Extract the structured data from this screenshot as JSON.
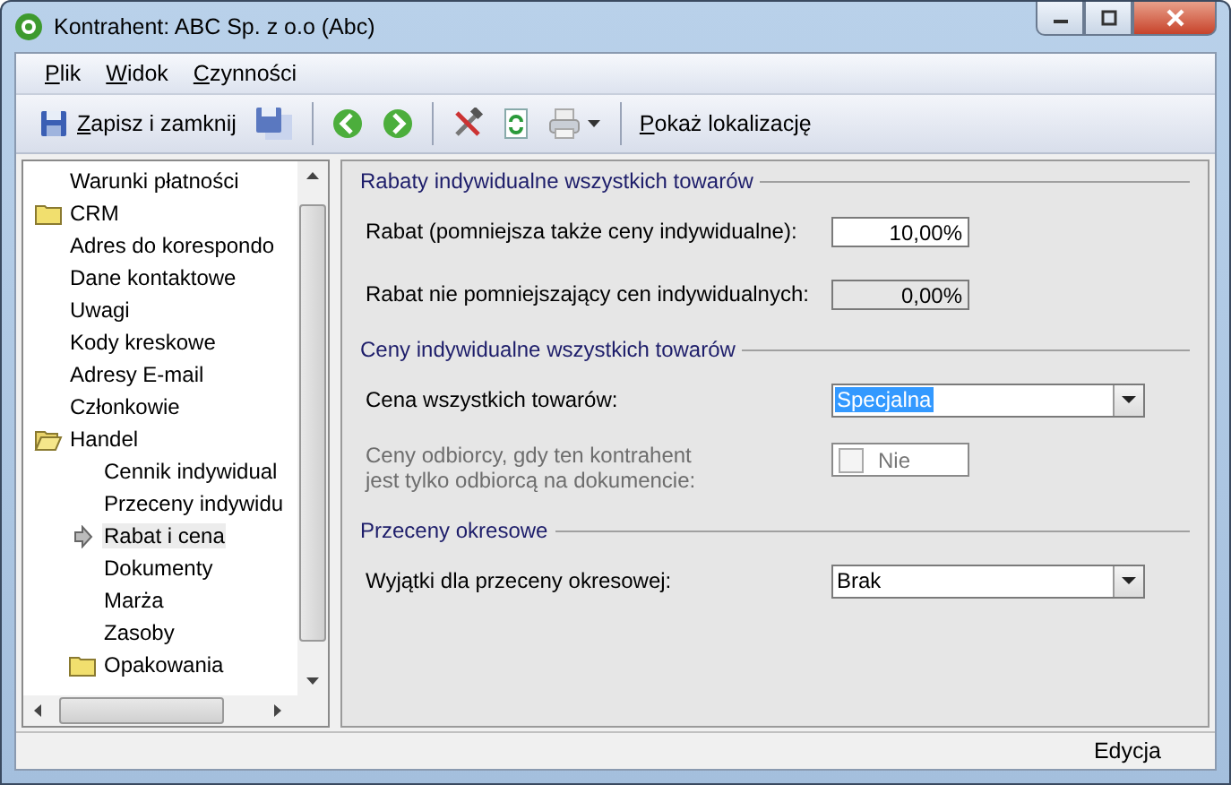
{
  "window": {
    "title": "Kontrahent: ABC Sp. z o.o (Abc)"
  },
  "menu": [
    {
      "label": "Plik",
      "mnemonic": true
    },
    {
      "label": "Widok",
      "mnemonic": true
    },
    {
      "label": "Czynności",
      "mnemonic": true
    }
  ],
  "toolbar": [
    {
      "kind": "save",
      "label": "Zapisz i zamknij",
      "mnemonic": true
    },
    {
      "kind": "save-as"
    },
    {
      "kind": "separator"
    },
    {
      "kind": "back"
    },
    {
      "kind": "forward"
    },
    {
      "kind": "separator"
    },
    {
      "kind": "tools"
    },
    {
      "kind": "refresh"
    },
    {
      "kind": "print"
    },
    {
      "kind": "separator"
    },
    {
      "kind": "link",
      "label": "Pokaż lokalizację",
      "mnemonic": true
    }
  ],
  "tree": [
    {
      "label": "Warunki płatności",
      "kind": "item",
      "selected": false
    },
    {
      "label": "CRM",
      "kind": "folder",
      "expanded": false,
      "selected": false
    },
    {
      "label": "Adres do korespondo",
      "kind": "item",
      "selected": false
    },
    {
      "label": "Dane kontaktowe",
      "kind": "item",
      "selected": false
    },
    {
      "label": "Uwagi",
      "kind": "item",
      "selected": false
    },
    {
      "label": "Kody kreskowe",
      "kind": "item",
      "selected": false
    },
    {
      "label": "Adresy E-mail",
      "kind": "item",
      "selected": false
    },
    {
      "label": "Członkowie",
      "kind": "item",
      "selected": false
    },
    {
      "label": "Handel",
      "kind": "folder",
      "expanded": true,
      "selected": false,
      "children": [
        {
          "label": "Cennik indywidual",
          "kind": "item",
          "selected": false
        },
        {
          "label": "Przeceny indywidu",
          "kind": "item",
          "selected": false
        },
        {
          "label": "Rabat i cena",
          "kind": "item",
          "selected": true
        },
        {
          "label": "Dokumenty",
          "kind": "item",
          "selected": false
        },
        {
          "label": "Marża",
          "kind": "item",
          "selected": false
        },
        {
          "label": "Zasoby",
          "kind": "item",
          "selected": false
        },
        {
          "label": "Opakowania",
          "kind": "folder",
          "expanded": false,
          "selected": false
        }
      ]
    }
  ],
  "sections": [
    {
      "title": "Rabaty indywidualne wszystkich towarów",
      "rows": [
        {
          "kind": "input",
          "label": "Rabat (pomniejsza także ceny indywidualne):",
          "value": "10,00%",
          "disabled": false
        },
        {
          "kind": "input",
          "label": "Rabat nie pomniejszający cen indywidualnych:",
          "value": "0,00%",
          "disabled": true
        }
      ]
    },
    {
      "title": "Ceny indywidualne wszystkich towarów",
      "rows": [
        {
          "kind": "select",
          "label": "Cena wszystkich towarów:",
          "value": "Specjalna",
          "highlighted": true
        },
        {
          "kind": "checkbox",
          "label": "Ceny odbiorcy, gdy ten kontrahent\njest tylko odbiorcą na dokumencie:",
          "value": "Nie",
          "checked": false,
          "disabled": true
        }
      ]
    },
    {
      "title": "Przeceny okresowe",
      "rows": [
        {
          "kind": "select",
          "label": "Wyjątki dla przeceny okresowej:",
          "value": "Brak",
          "highlighted": false
        }
      ]
    }
  ],
  "status_bar": {
    "mode": "Edycja"
  }
}
